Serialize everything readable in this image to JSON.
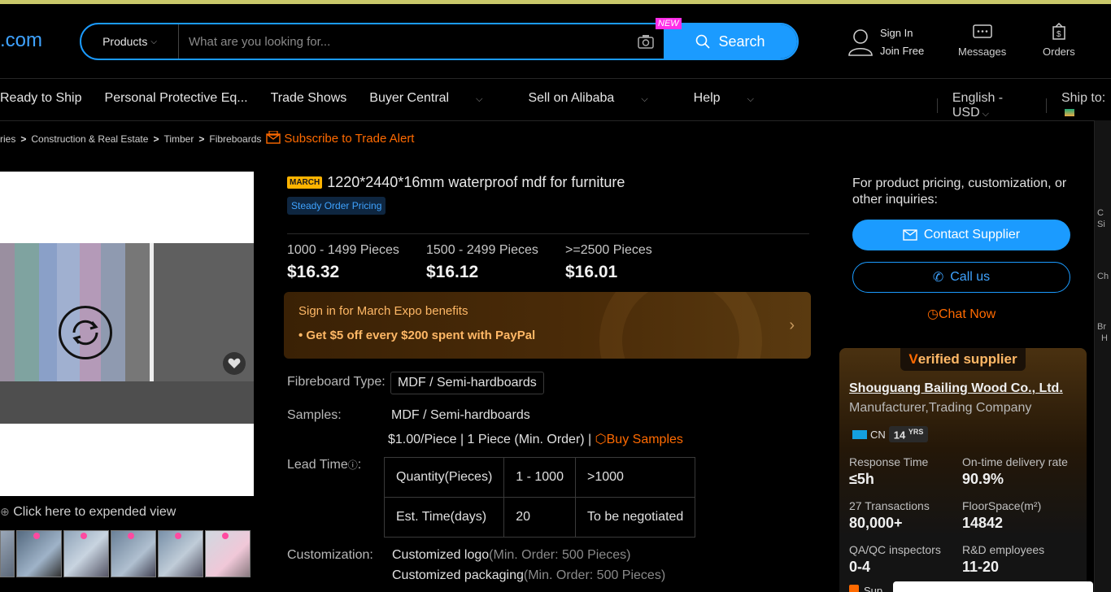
{
  "header": {
    "logo_text": ".com",
    "category_label": "Products",
    "search_placeholder": "What are you looking for...",
    "new_badge": "NEW",
    "search_button": "Search",
    "sign_in": "Sign In",
    "join_free": "Join Free",
    "messages": "Messages",
    "orders": "Orders"
  },
  "nav": {
    "items": [
      "Ready to Ship",
      "Personal Protective Eq...",
      "Trade Shows",
      "Buyer Central",
      "Sell on Alibaba",
      "Help"
    ],
    "language": "English - USD",
    "ship_to": "Ship to:"
  },
  "breadcrumb": {
    "items": [
      "ries",
      "Construction & Real Estate",
      "Timber",
      "Fibreboards"
    ],
    "separator": ">",
    "subscribe": "Subscribe to Trade Alert"
  },
  "gallery": {
    "expand_text": "Click here to expended view"
  },
  "product": {
    "march_tag": "MARCH",
    "title": "1220*2440*16mm waterproof mdf for furniture",
    "pricing_tag": "Steady Order Pricing",
    "tiers": [
      {
        "qty": "1000 - 1499 Pieces",
        "price": "$16.32"
      },
      {
        "qty": "1500 - 2499 Pieces",
        "price": "$16.12"
      },
      {
        "qty": ">=2500 Pieces",
        "price": "$16.01"
      }
    ],
    "promo_line1": "Sign in for March Expo benefits",
    "promo_line2": "• Get $5 off every $200 spent with PayPal",
    "fibreboard_label": "Fibreboard Type:",
    "fibreboard_value": "MDF / Semi-hardboards",
    "samples_label": "Samples:",
    "samples_value": "MDF / Semi-hardboards",
    "samples_price": "$1.00/Piece | 1 Piece (Min. Order) |",
    "buy_samples": "Buy Samples",
    "lead_time_label": "Lead Time",
    "lead_table": {
      "row1": [
        "Quantity(Pieces)",
        "1 - 1000",
        ">1000"
      ],
      "row2": [
        "Est. Time(days)",
        "20",
        "To be negotiated"
      ]
    },
    "customization_label": "Customization:",
    "custom_logo": "Customized logo",
    "custom_logo_moq": "(Min. Order: 500 Pieces)",
    "custom_pack": "Customized packaging",
    "custom_pack_moq": "(Min. Order: 500 Pieces)"
  },
  "supplier": {
    "inquiry_text": "For product pricing, customization, or other inquiries:",
    "contact_button": "Contact Supplier",
    "call_button": "Call us",
    "chat_now": "Chat Now",
    "verified_v": "V",
    "verified_rest": "erified supplier",
    "name": "Shouguang Bailing Wood Co., Ltd.",
    "type": "Manufacturer,Trading Company",
    "country": "CN",
    "years": "14",
    "years_unit": "YRS",
    "stats": [
      {
        "k": "Response Time",
        "v": "≤5h"
      },
      {
        "k": "On-time delivery rate",
        "v": "90.9%"
      },
      {
        "k": "27 Transactions",
        "v": "80,000+"
      },
      {
        "k": "FloorSpace(m²)",
        "v": "14842"
      },
      {
        "k": "QA/QC inspectors",
        "v": "0-4"
      },
      {
        "k": "R&D employees",
        "v": "11-20"
      }
    ],
    "bottom_partial": "Sup"
  },
  "sidebar": {
    "labels": [
      "C",
      "Si",
      "Ch",
      "Br",
      "H"
    ]
  }
}
